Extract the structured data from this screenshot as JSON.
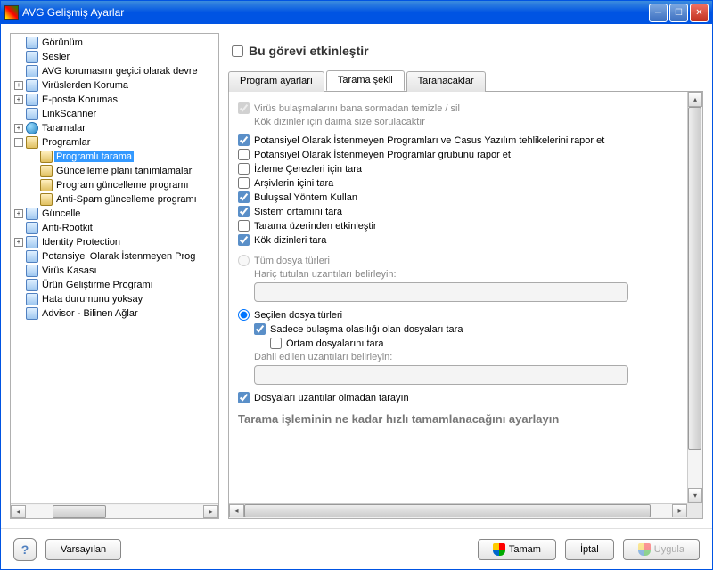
{
  "window": {
    "title": "AVG Gelişmiş Ayarlar"
  },
  "tree": {
    "items": [
      {
        "label": "Görünüm",
        "depth": 1,
        "expander": "none",
        "icon": "page"
      },
      {
        "label": "Sesler",
        "depth": 1,
        "expander": "none",
        "icon": "page"
      },
      {
        "label": "AVG korumasını geçici olarak devre",
        "depth": 1,
        "expander": "none",
        "icon": "page"
      },
      {
        "label": "Virüslerden Koruma",
        "depth": 1,
        "expander": "plus",
        "icon": "page"
      },
      {
        "label": "E-posta Koruması",
        "depth": 1,
        "expander": "plus",
        "icon": "page"
      },
      {
        "label": "LinkScanner",
        "depth": 1,
        "expander": "none",
        "icon": "page"
      },
      {
        "label": "Taramalar",
        "depth": 1,
        "expander": "plus",
        "icon": "scan"
      },
      {
        "label": "Programlar",
        "depth": 1,
        "expander": "minus",
        "icon": "sched"
      },
      {
        "label": "Programlı tarama",
        "depth": 2,
        "expander": "none",
        "icon": "sched",
        "selected": true
      },
      {
        "label": "Güncelleme planı tanımlamalar",
        "depth": 2,
        "expander": "none",
        "icon": "sched"
      },
      {
        "label": "Program güncelleme programı",
        "depth": 2,
        "expander": "none",
        "icon": "sched"
      },
      {
        "label": "Anti-Spam güncelleme programı",
        "depth": 2,
        "expander": "none",
        "icon": "sched"
      },
      {
        "label": "Güncelle",
        "depth": 1,
        "expander": "plus",
        "icon": "page"
      },
      {
        "label": "Anti-Rootkit",
        "depth": 1,
        "expander": "none",
        "icon": "page"
      },
      {
        "label": "Identity Protection",
        "depth": 1,
        "expander": "plus",
        "icon": "page"
      },
      {
        "label": "Potansiyel Olarak İstenmeyen Prog",
        "depth": 1,
        "expander": "none",
        "icon": "page"
      },
      {
        "label": "Virüs Kasası",
        "depth": 1,
        "expander": "none",
        "icon": "page"
      },
      {
        "label": "Ürün Geliştirme Programı",
        "depth": 1,
        "expander": "none",
        "icon": "page"
      },
      {
        "label": "Hata durumunu yoksay",
        "depth": 1,
        "expander": "none",
        "icon": "page"
      },
      {
        "label": "Advisor - Bilinen Ağlar",
        "depth": 1,
        "expander": "none",
        "icon": "page"
      }
    ]
  },
  "main": {
    "enable_label": "Bu görevi etkinleştir",
    "tabs": [
      {
        "label": "Program ayarları",
        "active": false
      },
      {
        "label": "Tarama şekli",
        "active": true
      },
      {
        "label": "Taranacaklar",
        "active": false
      }
    ],
    "opts": {
      "clean_label": "Virüs bulaşmalarını bana sormadan temizle / sil",
      "clean_note": "Kök dizinler için daima size sorulacaktır",
      "pup_report": "Potansiyel Olarak İstenmeyen Programları ve Casus Yazılım tehlikelerini rapor et",
      "pup_group": "Potansiyel Olarak İstenmeyen Programlar grubunu rapor et",
      "cookies": "İzleme Çerezleri için tara",
      "archives": "Arşivlerin içini tara",
      "heuristic": "Buluşsal Yöntem Kullan",
      "sysenv": "Sistem ortamını tara",
      "thorough": "Tarama üzerinden etkinleştir",
      "rootkits": "Kök dizinleri tara",
      "all_files": "Tüm dosya türleri",
      "exclude_label": "Hariç tutulan uzantıları belirleyin:",
      "sel_files": "Seçilen dosya türleri",
      "only_infect": "Sadece bulaşma olasılığı olan dosyaları tara",
      "media": "Ortam dosyalarını tara",
      "include_label": "Dahil edilen uzantıları belirleyin:",
      "no_ext": "Dosyaları uzantılar olmadan tarayın",
      "speed_head": "Tarama işleminin ne kadar hızlı tamamlanacağını ayarlayın"
    }
  },
  "footer": {
    "default": "Varsayılan",
    "ok": "Tamam",
    "cancel": "İptal",
    "apply": "Uygula"
  }
}
